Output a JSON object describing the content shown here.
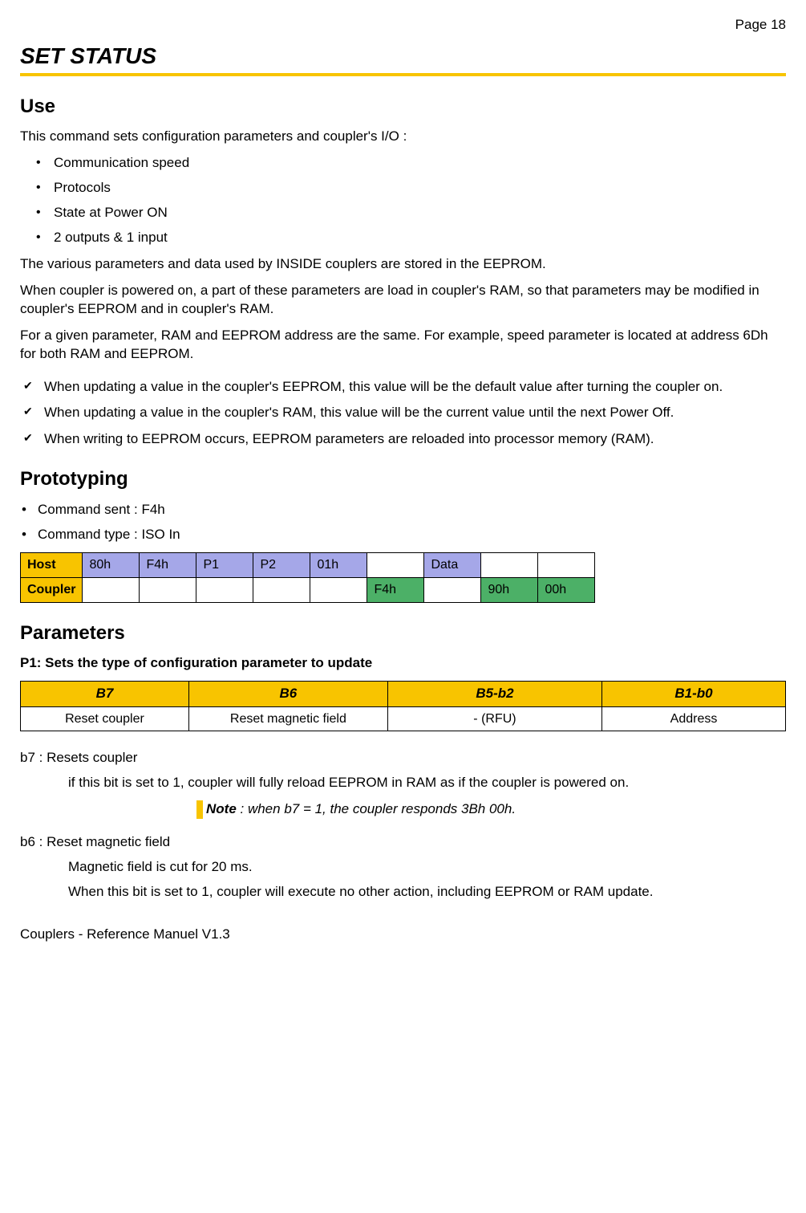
{
  "page_number": "Page 18",
  "title": "SET STATUS",
  "use": {
    "heading": "Use",
    "intro": "This command sets configuration parameters and coupler's I/O  :",
    "bullets": [
      "Communication speed",
      "Protocols",
      "State at Power ON",
      "2 outputs & 1 input"
    ],
    "p1": "The various parameters and data used by INSIDE couplers are stored in the EEPROM.",
    "p2": "When coupler is powered on, a part of these parameters are load in coupler's RAM, so that parameters may be modified in coupler's EEPROM and in coupler's RAM.",
    "p3": "For a given parameter, RAM and EEPROM address are the same. For example, speed parameter is located at address 6Dh for both RAM and EEPROM.",
    "checks": [
      "When updating a value in the coupler's EEPROM, this value will be the default value after turning the coupler on.",
      "When updating a value in the coupler's RAM, this value will be the current value until the next Power  Off.",
      "When writing to EEPROM occurs, EEPROM parameters are reloaded into processor memory (RAM)."
    ]
  },
  "prototyping": {
    "heading": "Prototyping",
    "bullets": [
      "Command sent : F4h",
      "Command type : ISO In"
    ],
    "table": {
      "row1_label": "Host",
      "row2_label": "Coupler",
      "host": [
        "80h",
        "F4h",
        "P1",
        "P2",
        "01h",
        "",
        "Data",
        "",
        ""
      ],
      "coupler": [
        "",
        "",
        "",
        "",
        "",
        "F4h",
        "",
        "90h",
        "00h"
      ]
    }
  },
  "parameters": {
    "heading": "Parameters",
    "p1_desc": "P1: Sets the type of configuration parameter to update",
    "headers": [
      "B7",
      "B6",
      "B5-b2",
      "B1-b0"
    ],
    "row": [
      "Reset coupler",
      "Reset magnetic field",
      "- (RFU)",
      "Address"
    ],
    "b7_label": "b7 : Resets coupler",
    "b7_text": "if this bit is set to 1, coupler will fully reload EEPROM in RAM as if the coupler is powered  on.",
    "note_label": "Note",
    "note_text": " : when b7 = 1, the coupler responds 3Bh 00h.",
    "b6_label": "b6 : Reset magnetic field",
    "b6_text1": "Magnetic field is cut for 20 ms.",
    "b6_text2": "When this bit is set to 1, coupler will execute no other action, including EEPROM or RAM update."
  },
  "footer": "Couplers - Reference Manuel V1.3"
}
